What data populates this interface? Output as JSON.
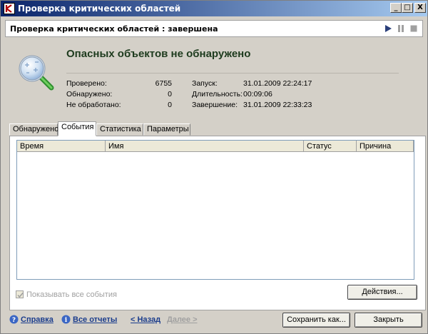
{
  "window": {
    "title": "Проверка критических областей"
  },
  "titlebar_buttons": {
    "minimize": "_",
    "maximize": "□",
    "close": "X"
  },
  "status_bar": {
    "text": "Проверка критических областей : завершена",
    "icons": [
      "play-icon",
      "pause-icon",
      "stop-icon"
    ]
  },
  "summary": {
    "headline": "Опасных объектов не обнаружено",
    "left_stats": [
      {
        "label": "Проверено:",
        "value": "6755"
      },
      {
        "label": "Обнаружено:",
        "value": "0"
      },
      {
        "label": "Не обработано:",
        "value": "0"
      }
    ],
    "right_stats": [
      {
        "label": "Запуск:",
        "value": "31.01.2009 22:24:17"
      },
      {
        "label": "Длительность:",
        "value": "00:09:06"
      },
      {
        "label": "Завершение:",
        "value": "31.01.2009 22:33:23"
      }
    ]
  },
  "tabs": [
    {
      "label": "Обнаружено",
      "active": false
    },
    {
      "label": "События",
      "active": true
    },
    {
      "label": "Статистика",
      "active": false
    },
    {
      "label": "Параметры",
      "active": false
    }
  ],
  "events_table": {
    "columns": [
      "Время",
      "Имя",
      "Статус",
      "Причина"
    ],
    "rows": []
  },
  "show_all_events": {
    "label": "Показывать все события",
    "checked": true,
    "enabled": false
  },
  "actions_button": "Действия...",
  "footer": {
    "help": "Справка",
    "all_reports": "Все отчеты",
    "back": "< Назад",
    "next": "Далее >",
    "save_as": "Сохранить как...",
    "close": "Закрыть"
  },
  "colors": {
    "titlebar_start": "#0a246a",
    "titlebar_end": "#a6caf0",
    "headline": "#1e3b1e",
    "link": "#1a3c8c",
    "dialog_bg": "#d4d0c8"
  }
}
